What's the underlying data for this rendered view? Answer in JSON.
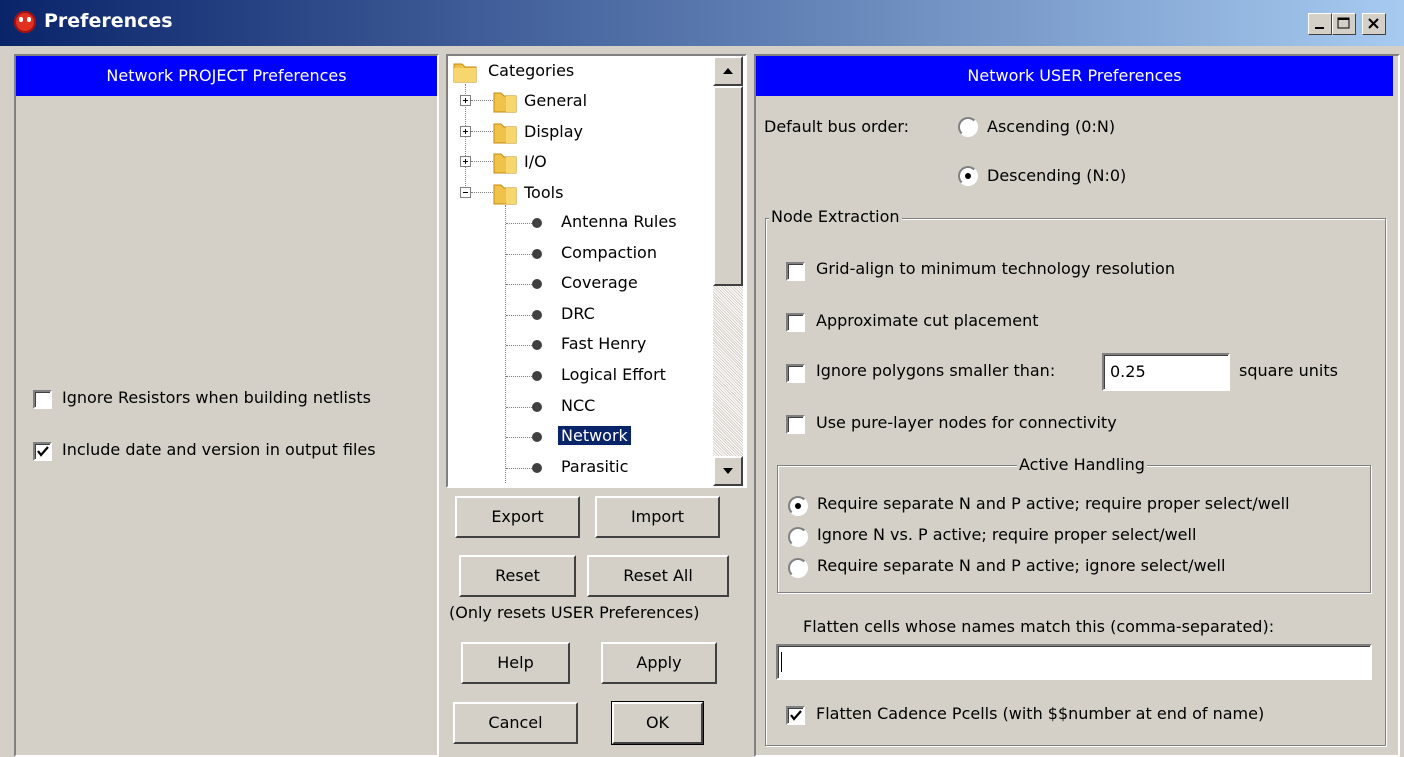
{
  "window": {
    "title": "Preferences"
  },
  "left_panel": {
    "header": "Network PROJECT Preferences",
    "options": [
      {
        "label": "Ignore Resistors when building netlists",
        "checked": false
      },
      {
        "label": "Include date and version in output files",
        "checked": true
      }
    ]
  },
  "tree": {
    "root": "Categories",
    "folders": [
      "General",
      "Display",
      "I/O",
      "Tools"
    ],
    "tools_items": [
      "Antenna Rules",
      "Compaction",
      "Coverage",
      "DRC",
      "Fast Henry",
      "Logical Effort",
      "NCC",
      "Network",
      "Parasitic"
    ],
    "selected": "Network"
  },
  "buttons": {
    "export": "Export",
    "import": "Import",
    "reset": "Reset",
    "reset_all": "Reset All",
    "reset_note": "(Only resets USER Preferences)",
    "help": "Help",
    "apply": "Apply",
    "cancel": "Cancel",
    "ok": "OK"
  },
  "right_panel": {
    "header": "Network USER Preferences",
    "bus_order_label": "Default bus order:",
    "bus_order_options": [
      "Ascending (0:N)",
      "Descending (N:0)"
    ],
    "bus_order_selected": "Descending (N:0)",
    "node_extraction": {
      "legend": "Node Extraction",
      "grid_align": "Grid-align to minimum technology resolution",
      "approx_cut": "Approximate cut placement",
      "ignore_polygons": "Ignore polygons smaller than:",
      "ignore_polygons_value": "0.25",
      "ignore_polygons_units": "square units",
      "pure_layer": "Use pure-layer nodes for connectivity",
      "active_handling": {
        "legend": "Active Handling",
        "options": [
          "Require separate N and P active; require proper select/well",
          "Ignore N vs. P active; require proper select/well",
          "Require separate N and P active; ignore select/well"
        ],
        "selected": 0
      },
      "flatten_label": "Flatten cells whose names match this (comma-separated):",
      "flatten_value": "",
      "flatten_pcells": "Flatten Cadence Pcells (with $$number at end of name)",
      "flatten_pcells_checked": true
    }
  },
  "colors": {
    "title_start": "#0a246a",
    "title_end": "#a6caf0",
    "header_blue": "#0000ff",
    "selection": "#0a246a",
    "face": "#d4d0c8"
  }
}
